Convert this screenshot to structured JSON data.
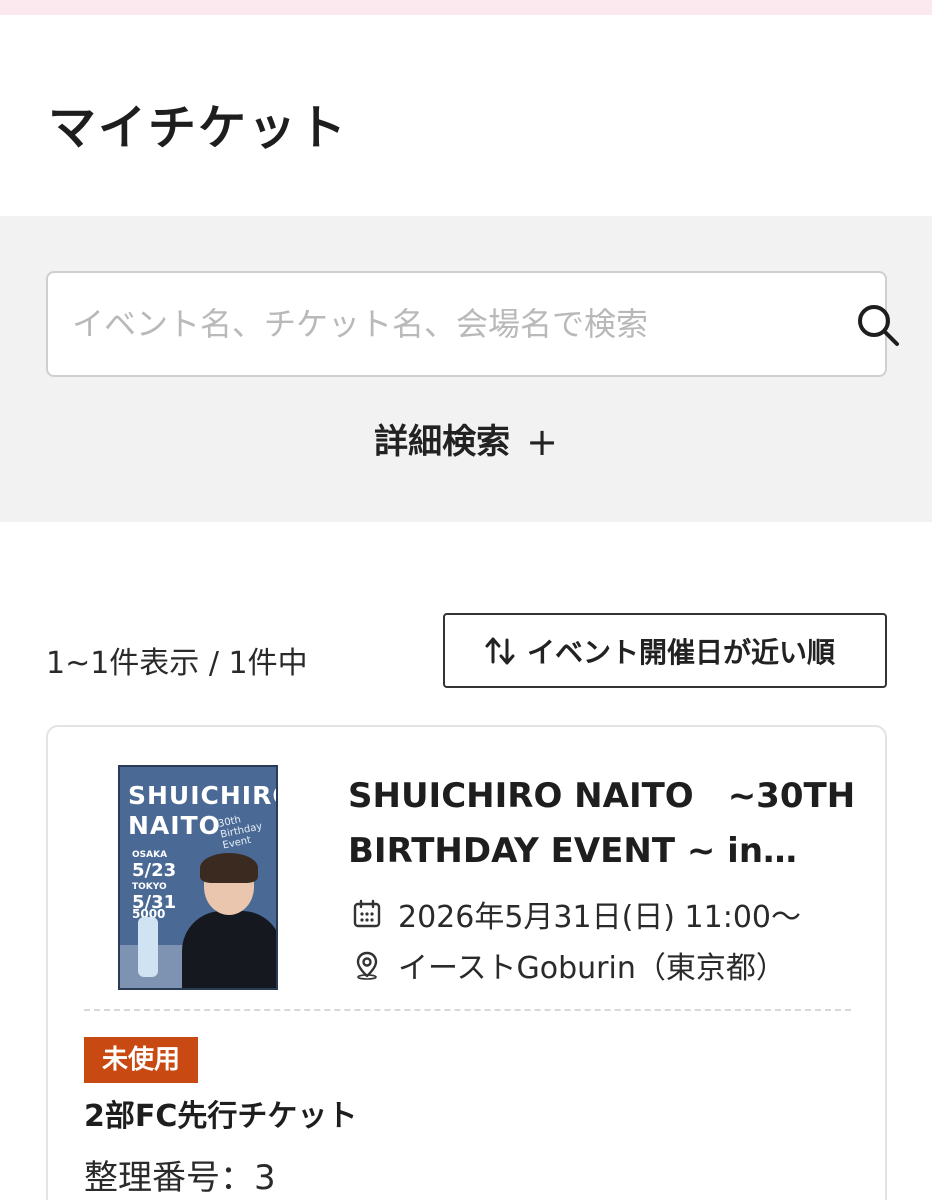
{
  "header": {
    "title": "マイチケット"
  },
  "search": {
    "placeholder": "イベント名、チケット名、会場名で検索",
    "advanced_label": "詳細検索",
    "advanced_icon": "plus-icon"
  },
  "results": {
    "count_text": "1~1件表示 / 1件中",
    "sort_label": "イベント開催日が近い順",
    "sort_icon": "sort-arrows-icon"
  },
  "tickets": [
    {
      "title_line1": "SHUICHIRO NAITO　~30TH",
      "title_line2": "BIRTHDAY EVENT ~ in…",
      "datetime": "2026年5月31日(日) 11:00〜",
      "venue": "イーストGoburin（東京都）",
      "status": "未使用",
      "ticket_name": "2部FC先行チケット",
      "seat_number": "整理番号：3",
      "poster": {
        "title": "SHUICHIRO NAITO",
        "subtitle": "30th Birthday Event",
        "osaka_label": "OSAKA",
        "osaka_date": "5/23",
        "tokyo_label": "TOKYO",
        "tokyo_date": "5/31",
        "tix": "5000"
      }
    }
  ],
  "colors": {
    "top_bar": "#fce8ef",
    "search_panel_bg": "#f2f2f2",
    "status_badge_bg": "#c84a12",
    "poster_bg": "#4a6a95"
  }
}
